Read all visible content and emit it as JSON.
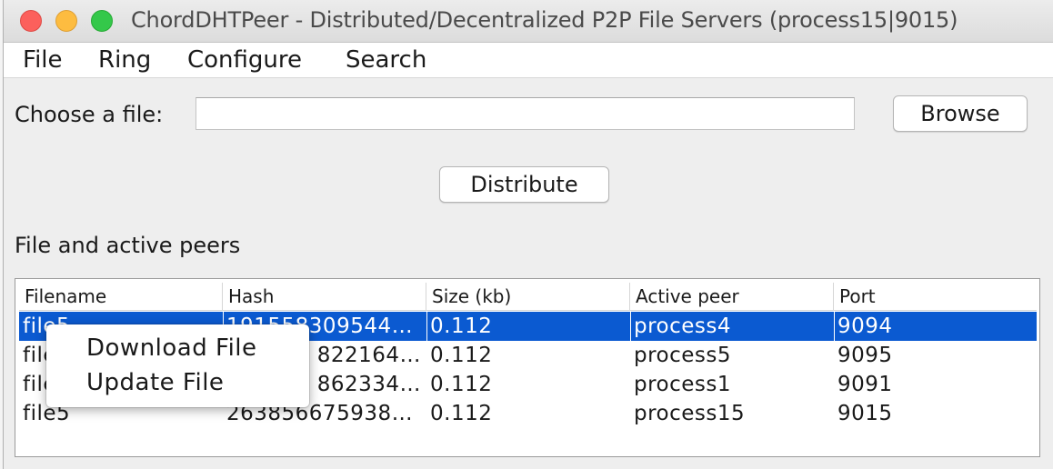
{
  "window": {
    "title": "ChordDHTPeer - Distributed/Decentralized P2P File Servers (process15|9015)"
  },
  "menubar": {
    "items": [
      "File",
      "Ring",
      "Configure",
      "Search"
    ]
  },
  "chooser": {
    "label": "Choose a file:",
    "value": "",
    "browse_label": "Browse"
  },
  "distribute_label": "Distribute",
  "section_label": "File and active peers",
  "table": {
    "columns": [
      "Filename",
      "Hash",
      "Size (kb)",
      "Active peer",
      "Port"
    ],
    "rows": [
      {
        "filename": "file5",
        "hash": "191558309544…",
        "size": "0.112",
        "peer": "process4",
        "port": "9094"
      },
      {
        "filename": "file",
        "hash": "822164…",
        "size": "0.112",
        "peer": "process5",
        "port": "9095"
      },
      {
        "filename": "file",
        "hash": "862334…",
        "size": "0.112",
        "peer": "process1",
        "port": "9091"
      },
      {
        "filename": "file5",
        "hash": "263856675938…",
        "size": "0.112",
        "peer": "process15",
        "port": "9015"
      }
    ],
    "selected_row": 0
  },
  "context_menu": {
    "items": [
      "Download File",
      "Update File"
    ]
  },
  "colors": {
    "selection": "#0b5ad1",
    "close": "#fc605c",
    "minimize": "#fdbc40",
    "maximize": "#34c84a"
  }
}
